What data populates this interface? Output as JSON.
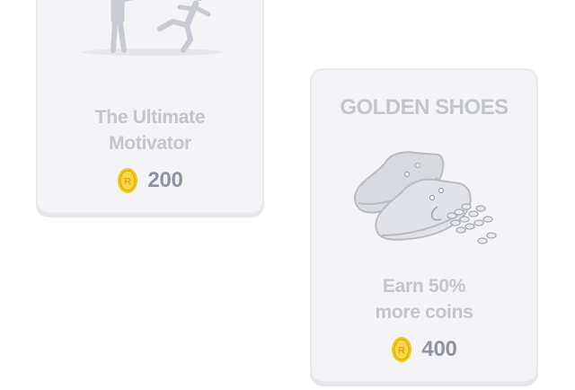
{
  "cards": [
    {
      "title": "",
      "illustration": "motivator-kick-illustration",
      "description_lines": [
        "The Ultimate",
        "Motivator"
      ],
      "price": "200",
      "currency_icon": "gold-coin-icon"
    },
    {
      "title": "GOLDEN SHOES",
      "illustration": "golden-shoes-illustration",
      "description_lines": [
        "Earn 50%",
        "more coins"
      ],
      "price": "400",
      "currency_icon": "gold-coin-icon"
    }
  ],
  "colors": {
    "card_background": "#f4f4f6",
    "card_border": "#e9e9ee",
    "muted_text": "#c3c5cc",
    "price_text": "#8f93a0",
    "coin": "#f5c518"
  }
}
